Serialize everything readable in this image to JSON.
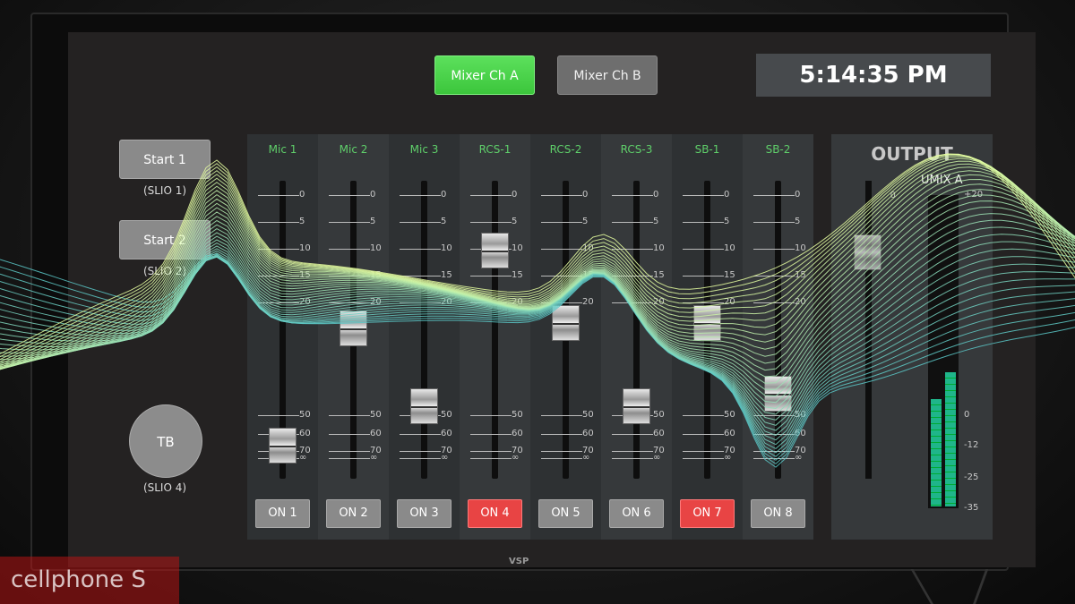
{
  "header": {
    "tabs": [
      {
        "label": "Mixer Ch A",
        "active": true
      },
      {
        "label": "Mixer Ch B",
        "active": false
      }
    ],
    "clock": "5:14:35 PM"
  },
  "left_panel": {
    "start1": {
      "label": "Start 1",
      "sub": "(SLIO 1)"
    },
    "start2": {
      "label": "Start 2",
      "sub": "(SLIO 2)"
    },
    "tb": {
      "label": "TB",
      "sub": "(SLIO 4)"
    }
  },
  "scale_labels": [
    "0",
    "5",
    "10",
    "15",
    "20",
    "50",
    "60",
    "70",
    "∞"
  ],
  "channels": [
    {
      "name": "Mic 1",
      "on_label": "ON 1",
      "on": false,
      "fader_level": 0.05
    },
    {
      "name": "Mic 2",
      "on_label": "ON 2",
      "on": false,
      "fader_level": 0.5
    },
    {
      "name": "Mic 3",
      "on_label": "ON 3",
      "on": false,
      "fader_level": 0.2
    },
    {
      "name": "RCS-1",
      "on_label": "ON 4",
      "on": true,
      "fader_level": 0.8
    },
    {
      "name": "RCS-2",
      "on_label": "ON 5",
      "on": false,
      "fader_level": 0.52
    },
    {
      "name": "RCS-3",
      "on_label": "ON 6",
      "on": false,
      "fader_level": 0.2
    },
    {
      "name": "SB-1",
      "on_label": "ON 7",
      "on": true,
      "fader_level": 0.52
    },
    {
      "name": "SB-2",
      "on_label": "ON 8",
      "on": false,
      "fader_level": 0.25
    }
  ],
  "output": {
    "title": "OUTPUT",
    "meter_label": "UMIX A",
    "meter_scale": [
      "+20",
      "0",
      "-12",
      "-25",
      "-35"
    ],
    "zero_label": "0"
  },
  "device": {
    "logo": "VSP"
  },
  "watermark": "cellphone S",
  "colors": {
    "active_tab": "#3cc63c",
    "on_active": "#e84444",
    "channel_name": "#5fcf6a",
    "wave": "#5fd6c8"
  }
}
